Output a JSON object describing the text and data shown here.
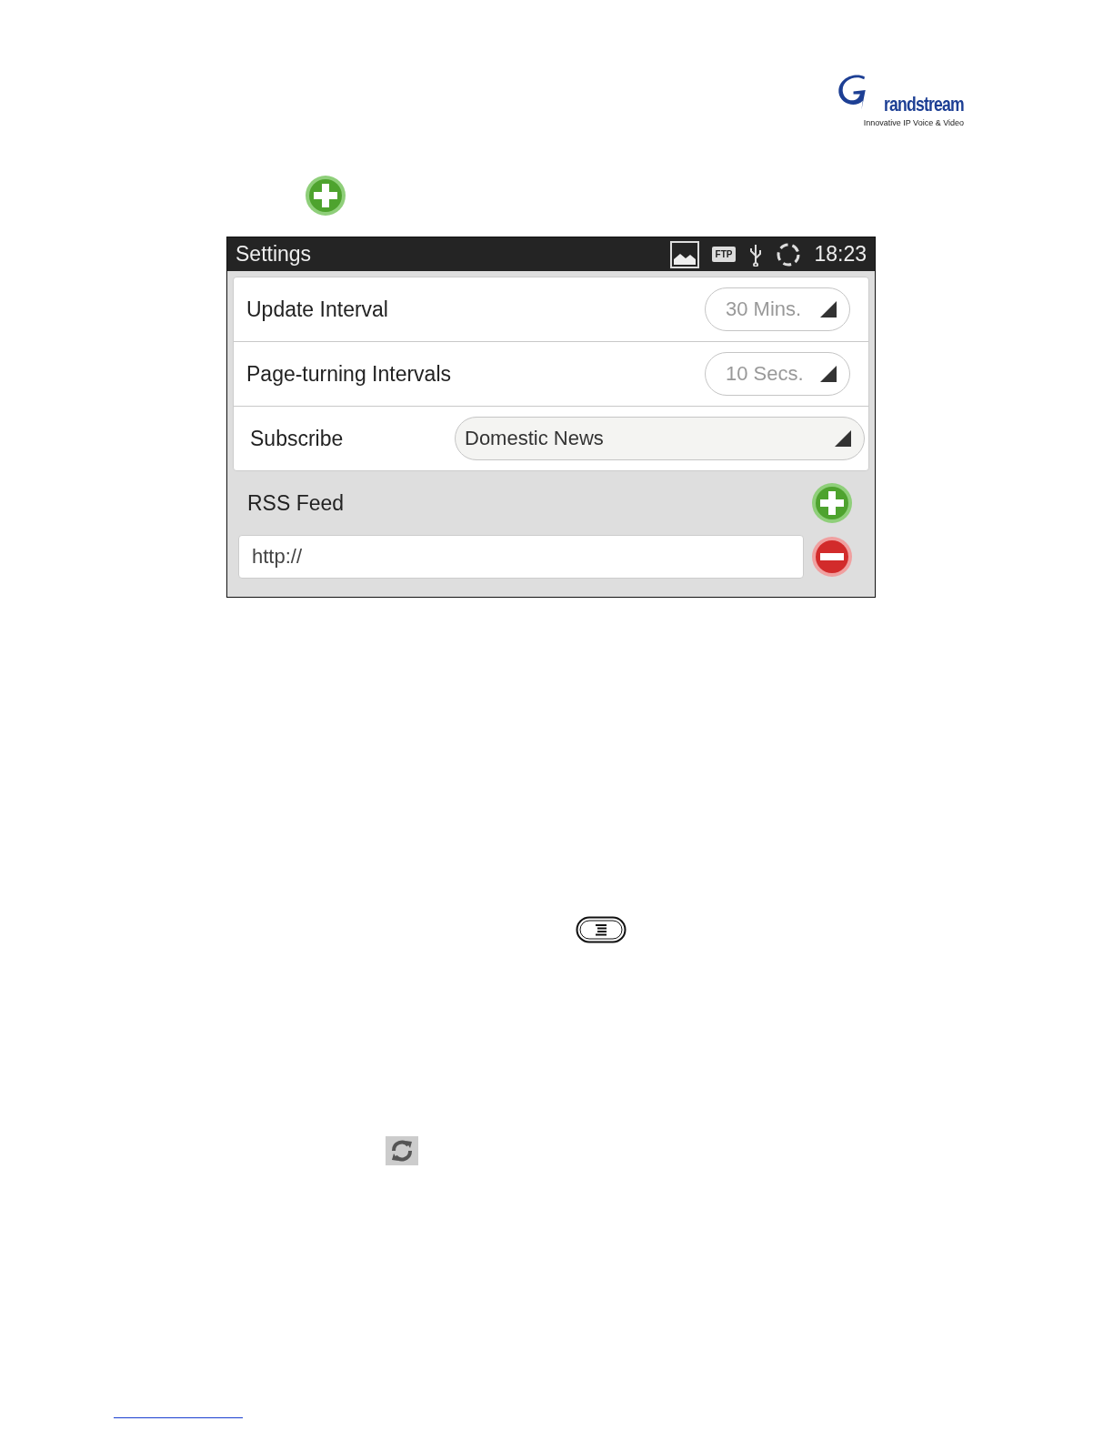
{
  "logo": {
    "wordmark": "randstream",
    "tagline": "Innovative IP Voice & Video"
  },
  "status_bar": {
    "title": "Settings",
    "ftp": "FTP",
    "time": "18:23"
  },
  "settings": [
    {
      "kind": "spinner",
      "label": "Update Interval",
      "value": "30 Mins."
    },
    {
      "kind": "spinner",
      "label": "Page-turning Intervals",
      "value": "10 Secs."
    },
    {
      "kind": "wide_spinner",
      "label": "Subscribe",
      "value": "Domestic News"
    }
  ],
  "rss_feed": {
    "label": "RSS Feed",
    "fields": [
      {
        "value": "http://"
      }
    ]
  }
}
